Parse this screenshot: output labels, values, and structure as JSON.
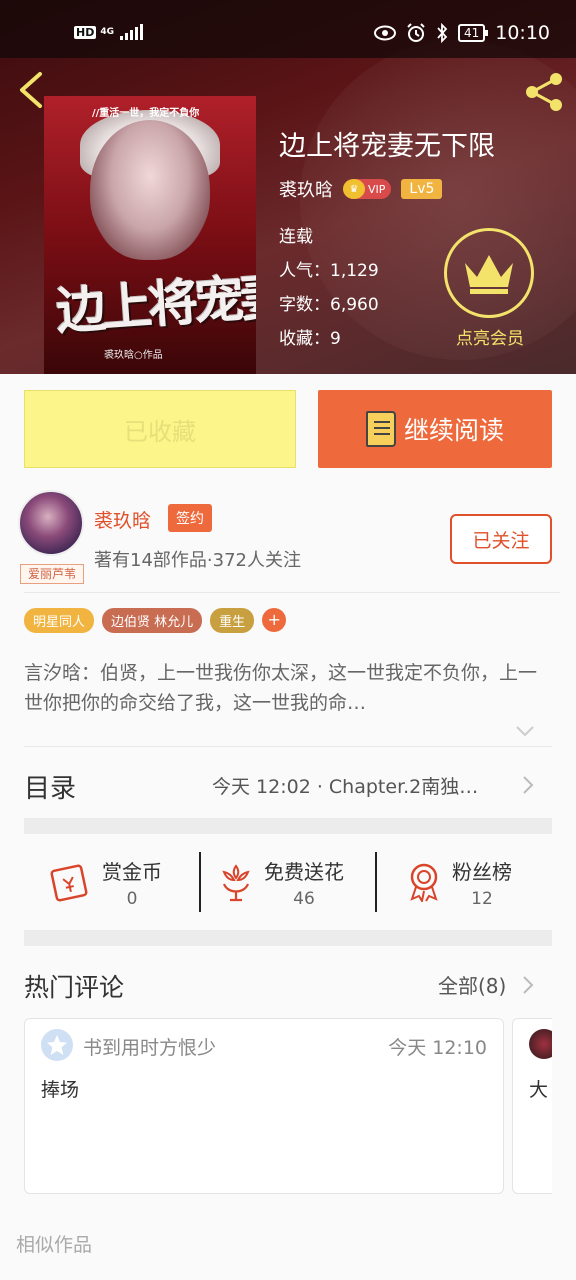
{
  "status": {
    "hd": "HD",
    "network": "4G",
    "time": "10:10",
    "battery": "41"
  },
  "book": {
    "title": "边上将宠妻无下限",
    "author": "裘玖晗",
    "vip": "VIP",
    "level": "Lv5",
    "state": "连载",
    "popularity": "人气：1,129",
    "words": "字数：6,960",
    "favorites": "收藏：9",
    "cover_top": "//重活一世，我定不負你",
    "cover_title": "边上将宠妻",
    "cover_sub": "裘玖晗○作品"
  },
  "member": {
    "label": "点亮会员"
  },
  "buttons": {
    "collected": "已收藏",
    "continue": "继续阅读"
  },
  "author": {
    "name": "裘玖晗",
    "sign": "签约",
    "meta": "著有14部作品·372人关注",
    "follow": "已关注",
    "avatar_tag": "爱丽芦苇"
  },
  "tags": [
    {
      "label": "明星同人",
      "color": "#f1b440"
    },
    {
      "label": "边伯贤 林允儿",
      "color": "#c86c52"
    },
    {
      "label": "重生",
      "color": "#c8a040"
    }
  ],
  "tag_plus": "+",
  "description": "言汐晗：伯贤，上一世我伤你太深，这一世我定不负你，上一世你把你的命交给了我，这一世我的命…",
  "toc": {
    "label": "目录",
    "latest": "今天 12:02 · Chapter.2南独…"
  },
  "actions": [
    {
      "label": "赏金币",
      "value": "0",
      "icon": "red-envelope-icon"
    },
    {
      "label": "免费送花",
      "value": "46",
      "icon": "flower-icon"
    },
    {
      "label": "粉丝榜",
      "value": "12",
      "icon": "medal-icon"
    }
  ],
  "comments": {
    "title": "热门评论",
    "all": "全部(8)",
    "items": [
      {
        "user": "书到用时方恨少",
        "time": "今天 12:10",
        "text": "捧场"
      },
      {
        "user": "",
        "time": "",
        "text": "大"
      }
    ]
  },
  "similar": "相似作品",
  "colors": {
    "accent": "#ee6a3c",
    "gold": "#f4e36a",
    "collected_bg": "#fbf58a"
  }
}
